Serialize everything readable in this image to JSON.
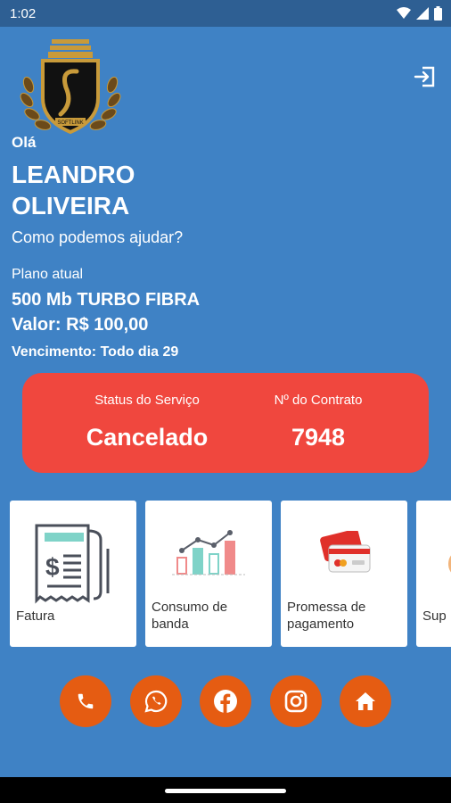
{
  "status_bar": {
    "time": "1:02",
    "icons": [
      "wifi-icon",
      "signal-icon",
      "battery-icon"
    ]
  },
  "header": {
    "logo_text": "SOFTLINK",
    "logout_icon": "logout-icon"
  },
  "greeting": {
    "hello": "Olá",
    "name_line1": "LEANDRO",
    "name_line2": "OLIVEIRA",
    "help": "Como podemos ajudar?"
  },
  "plan": {
    "label": "Plano atual",
    "name": "500 Mb TURBO FIBRA",
    "value": "Valor: R$ 100,00",
    "due": "Vencimento: Todo dia 29"
  },
  "status_card": {
    "status_label": "Status do Serviço",
    "status_value": "Cancelado",
    "contract_label": "Nº do Contrato",
    "contract_value": "7948",
    "color": "#f0473e"
  },
  "tiles": [
    {
      "label": "Fatura",
      "icon": "invoice-icon"
    },
    {
      "label_line1": "Consumo de",
      "label_line2": "banda",
      "icon": "bar-chart-icon"
    },
    {
      "label_line1": "Promessa de",
      "label_line2": "pagamento",
      "icon": "credit-card-icon"
    },
    {
      "label": "Sup",
      "icon": "support-icon"
    }
  ],
  "social": [
    "phone-icon",
    "whatsapp-icon",
    "facebook-icon",
    "instagram-icon",
    "home-icon"
  ],
  "colors": {
    "background": "#3f82c5",
    "status_bar": "#2e5f93",
    "accent": "#e55c12"
  }
}
